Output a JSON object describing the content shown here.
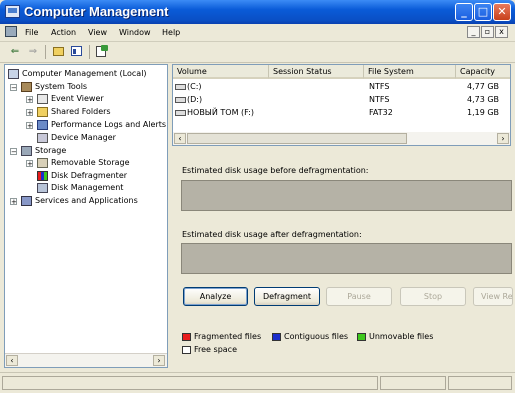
{
  "window": {
    "title": "Computer Management",
    "min": "_",
    "max": "□",
    "close": "✕"
  },
  "menu": {
    "items": [
      "File",
      "Action",
      "View",
      "Window",
      "Help"
    ],
    "mdi_min": "_",
    "mdi_restore": "▫",
    "mdi_close": "x"
  },
  "toolbar": {
    "back": "⇐",
    "forward": "⇒"
  },
  "tree": {
    "root": "Computer Management (Local)",
    "system_tools": "System Tools",
    "event_viewer": "Event Viewer",
    "shared_folders": "Shared Folders",
    "perf_logs": "Performance Logs and Alerts",
    "device_manager": "Device Manager",
    "storage": "Storage",
    "removable_storage": "Removable Storage",
    "disk_defrag": "Disk Defragmenter",
    "disk_management": "Disk Management",
    "services": "Services and Applications"
  },
  "volumes": {
    "columns": [
      "Volume",
      "Session Status",
      "File System",
      "Capacity"
    ],
    "rows": [
      {
        "volume": "(C:)",
        "status": "",
        "fs": "NTFS",
        "capacity": "4,77 GB"
      },
      {
        "volume": "(D:)",
        "status": "",
        "fs": "NTFS",
        "capacity": "4,73 GB"
      },
      {
        "volume": "НОВЫЙ ТОМ (F:)",
        "status": "",
        "fs": "FAT32",
        "capacity": "1,19 GB"
      }
    ]
  },
  "defrag": {
    "before_label": "Estimated disk usage before defragmentation:",
    "after_label": "Estimated disk usage after defragmentation:",
    "buttons": {
      "analyze": "Analyze",
      "defragment": "Defragment",
      "pause": "Pause",
      "stop": "Stop",
      "view_report": "View Report"
    },
    "legend": {
      "fragmented": "Fragmented files",
      "contiguous": "Contiguous files",
      "unmovable": "Unmovable files",
      "free": "Free space"
    },
    "colors": {
      "fragmented": "#e81c1c",
      "contiguous": "#1c2ecc",
      "unmovable": "#3ec81c",
      "free": "#ffffff"
    }
  }
}
